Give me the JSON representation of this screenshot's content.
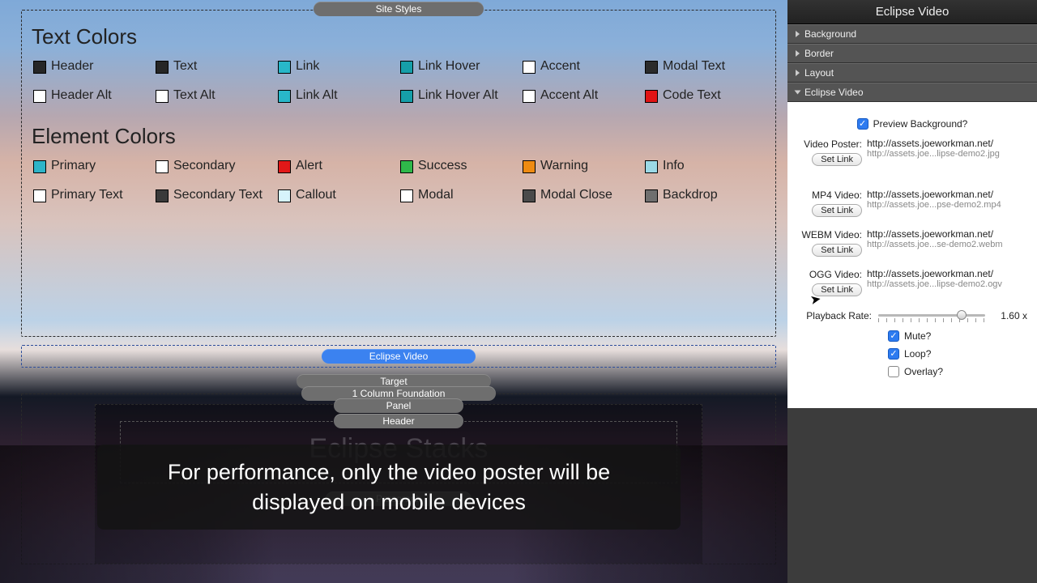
{
  "canvas": {
    "site_styles_label": "Site Styles",
    "text_colors_title": "Text Colors",
    "text_colors": [
      {
        "label": "Header",
        "color": "#262626"
      },
      {
        "label": "Text",
        "color": "#262626"
      },
      {
        "label": "Link",
        "color": "#28b7c9"
      },
      {
        "label": "Link Hover",
        "color": "#169fa9"
      },
      {
        "label": "Accent",
        "color": "#ffffff"
      },
      {
        "label": "Modal Text",
        "color": "#2b2b2b"
      },
      {
        "label": "Header Alt",
        "color": "#ffffff"
      },
      {
        "label": "Text Alt",
        "color": "#ffffff"
      },
      {
        "label": "Link Alt",
        "color": "#28b7c9"
      },
      {
        "label": "Link Hover Alt",
        "color": "#169fa9"
      },
      {
        "label": "Accent Alt",
        "color": "#ffffff"
      },
      {
        "label": "Code Text",
        "color": "#e11414"
      }
    ],
    "element_colors_title": "Element Colors",
    "element_colors": [
      {
        "label": "Primary",
        "color": "#2eb4c8"
      },
      {
        "label": "Secondary",
        "color": "#ffffff"
      },
      {
        "label": "Alert",
        "color": "#e21818"
      },
      {
        "label": "Success",
        "color": "#2fb84a"
      },
      {
        "label": "Warning",
        "color": "#ef8b12"
      },
      {
        "label": "Info",
        "color": "#9bd9e6"
      },
      {
        "label": "Primary Text",
        "color": "#ffffff"
      },
      {
        "label": "Secondary Text",
        "color": "#3a3a3a"
      },
      {
        "label": "Callout",
        "color": "#d7f3fb"
      },
      {
        "label": "Modal",
        "color": "#ffffff"
      },
      {
        "label": "Modal Close",
        "color": "#4a4a4a"
      },
      {
        "label": "Backdrop",
        "color": "#6f6f6f"
      }
    ],
    "eclipse_video_label": "Eclipse Video",
    "target_label": "Target",
    "foundation_label": "1 Column Foundation",
    "panel_label": "Panel",
    "header_label": "Header",
    "header_content": "Eclipse Stacks",
    "paragraph_label": "Paragraph"
  },
  "caption": "For performance, only the video poster will be displayed on mobile devices",
  "inspector": {
    "title": "Eclipse Video",
    "sections": {
      "background": "Background",
      "border": "Border",
      "layout": "Layout",
      "eclipse_video": "Eclipse Video"
    },
    "preview_bg_label": "Preview Background?",
    "preview_bg_checked": true,
    "set_link_label": "Set Link",
    "links": [
      {
        "label": "Video Poster:",
        "url": "http://assets.joeworkman.net/",
        "sub": "http://assets.joe...lipse-demo2.jpg"
      },
      {
        "label": "MP4 Video:",
        "url": "http://assets.joeworkman.net/",
        "sub": "http://assets.joe...pse-demo2.mp4"
      },
      {
        "label": "WEBM Video:",
        "url": "http://assets.joeworkman.net/",
        "sub": "http://assets.joe...se-demo2.webm"
      },
      {
        "label": "OGG Video:",
        "url": "http://assets.joeworkman.net/",
        "sub": "http://assets.joe...lipse-demo2.ogv"
      }
    ],
    "playback_rate_label": "Playback Rate:",
    "playback_rate_value": "1.60 x",
    "mute_label": "Mute?",
    "mute_checked": true,
    "loop_label": "Loop?",
    "loop_checked": true,
    "overlay_label": "Overlay?",
    "overlay_checked": false
  }
}
